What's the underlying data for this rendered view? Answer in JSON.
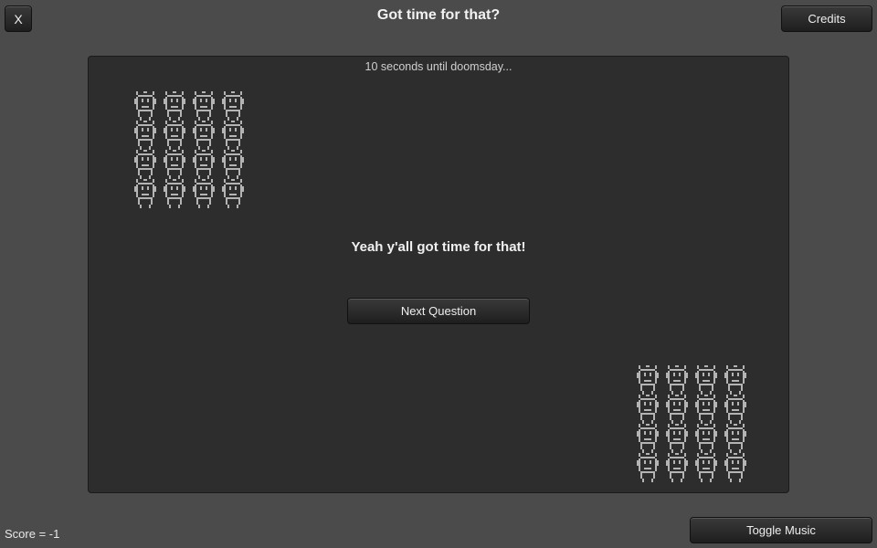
{
  "header": {
    "close_label": "X",
    "title": "Got time for that?",
    "credits_label": "Credits"
  },
  "panel": {
    "countdown": "10 seconds until doomsday...",
    "result": "Yeah y'all got time for that!",
    "next_label": "Next Question"
  },
  "sprites": {
    "icon": "pixel-robot-icon",
    "color": "#b4b4b4",
    "rows": 4,
    "cols": 4
  },
  "footer": {
    "score": "Score = -1",
    "music_label": "Toggle Music"
  }
}
